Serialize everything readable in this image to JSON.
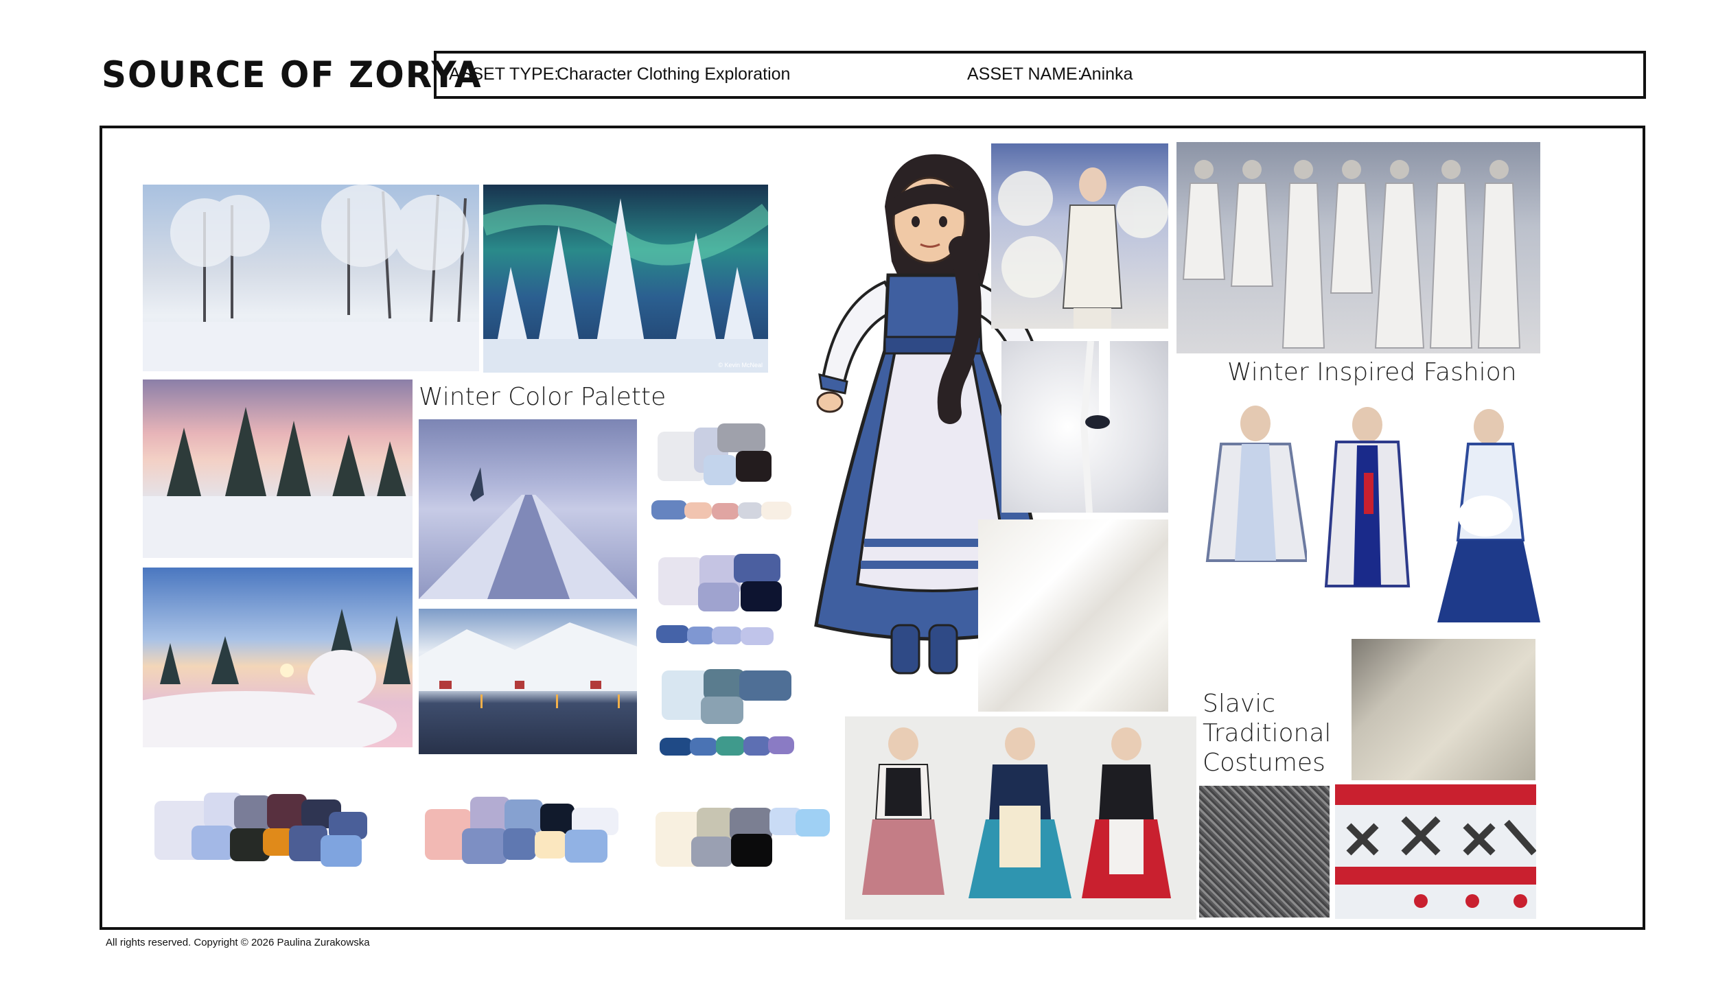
{
  "brand": "SOURCE OF ZORYA",
  "header": {
    "asset_type_label": "ASSET TYPE:",
    "asset_type_value": "Character Clothing Exploration",
    "asset_name_label": "ASSET NAME:",
    "asset_name_value": "Aninka"
  },
  "captions": {
    "winter_palette": "Winter Color Palette",
    "winter_fashion": "Winter Inspired Fashion",
    "slavic_line1": "Slavic",
    "slavic_line2": "Traditional",
    "slavic_line3": "Costumes"
  },
  "image_credit": "© Kevin McNeal",
  "footer": "All rights reserved. Copyright © 2026 Paulina Zurakowska",
  "colors": {
    "snow": "#eef1f7",
    "ice_blue": "#b8c7e6",
    "dress_blue": "#3f5fa0",
    "navy": "#0f1e3d",
    "lavender": "#a9a5d6",
    "pink_dusk": "#f0b7b2",
    "teal": "#3f9a8c",
    "red_embroidery": "#c9202f"
  }
}
